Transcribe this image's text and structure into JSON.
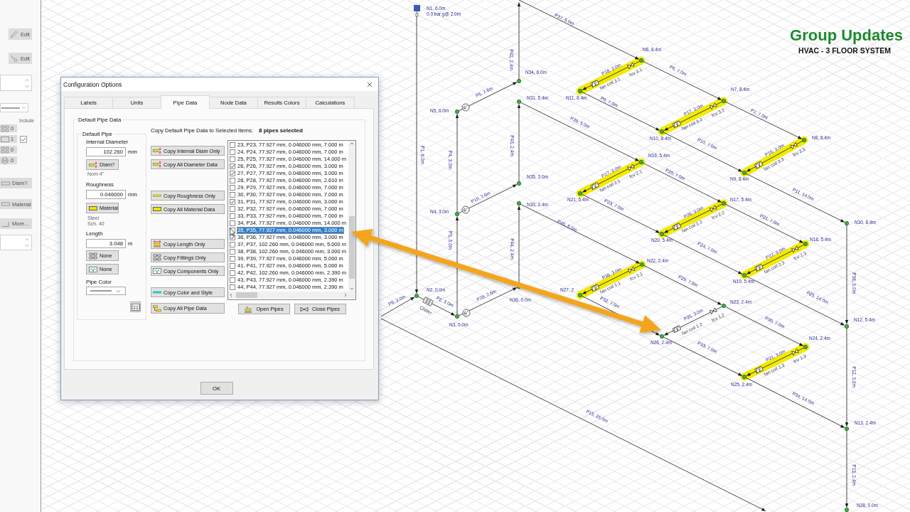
{
  "side_panel": {
    "edit_buttons": [
      {
        "label": "Edit",
        "disabled": true
      },
      {
        "label": "Edit",
        "disabled": true
      }
    ],
    "include": {
      "label": "Include",
      "checked": true
    },
    "counters": [
      "0",
      "1",
      "0",
      "0"
    ],
    "buttons": [
      {
        "label": "Diam?",
        "disabled": true
      },
      {
        "label": "Material",
        "disabled": true
      },
      {
        "label": "More...",
        "disabled": true
      }
    ]
  },
  "dialog": {
    "title": "Configuration Options",
    "tabs": [
      {
        "label": "Labels",
        "selected": false
      },
      {
        "label": "Units",
        "selected": false
      },
      {
        "label": "Pipe Data",
        "selected": true
      },
      {
        "label": "Node Data",
        "selected": false
      },
      {
        "label": "Results Colors",
        "selected": false
      },
      {
        "label": "Calculations",
        "selected": false
      }
    ],
    "group_title": "Default Pipe Data",
    "default_pipe": {
      "title": "Default Pipe",
      "diameter": {
        "label": "Internal Diameter",
        "value": "102.260",
        "unit": "mm",
        "button": "Diam?",
        "notes": [
          "Nom 4\""
        ]
      },
      "roughness": {
        "label": "Roughness",
        "value": "0.046000",
        "unit": "mm",
        "button": "Material",
        "notes": [
          "Steel",
          "Sch. 40"
        ]
      },
      "length": {
        "label": "Length",
        "value": "3.048",
        "unit": "m"
      },
      "fittings_button": "None",
      "components_button": "None",
      "color_label": "Pipe Color"
    },
    "copy_heading": "Copy Default Pipe Data to Selected Items:",
    "selection_count": "8 pipes selected",
    "copy_groups": [
      [
        "Copy Internal Diam Only",
        "Copy All Diameter Data"
      ],
      [
        "Copy Roughness Only",
        "Copy All Material Data"
      ],
      [
        "Copy Length Only",
        "Copy Fittings Only",
        "Copy Components Only"
      ],
      [
        "Copy Color and Style"
      ],
      [
        "Copy All Pipe Data"
      ]
    ],
    "pipe_list": [
      {
        "text": "23, P23, 77.927 mm, 0.046000 mm, 7.000 m",
        "checked": false,
        "selected": false
      },
      {
        "text": "24, P24, 77.927 mm, 0.046000 mm, 7.000 m",
        "checked": false,
        "selected": false
      },
      {
        "text": "25, P25, 77.927 mm, 0.046000 mm, 14.000 m",
        "checked": false,
        "selected": false
      },
      {
        "text": "26, P26, 77.927 mm, 0.046000 mm, 3.000 m",
        "checked": true,
        "selected": false
      },
      {
        "text": "27, P27, 77.927 mm, 0.046000 mm, 3.000 m",
        "checked": true,
        "selected": false
      },
      {
        "text": "28, P28, 77.927 mm, 0.046000 mm, 2.610 m",
        "checked": false,
        "selected": false
      },
      {
        "text": "29, P29, 77.927 mm, 0.046000 mm, 7.000 m",
        "checked": false,
        "selected": false
      },
      {
        "text": "30, P30, 77.927 mm, 0.046000 mm, 7.000 m",
        "checked": false,
        "selected": false
      },
      {
        "text": "31, P31, 77.927 mm, 0.046000 mm, 3.000 m",
        "checked": true,
        "selected": false
      },
      {
        "text": "32, P32, 77.927 mm, 0.046000 mm, 7.000 m",
        "checked": false,
        "selected": false
      },
      {
        "text": "33, P33, 77.927 mm, 0.046000 mm, 7.000 m",
        "checked": false,
        "selected": false
      },
      {
        "text": "34, P34, 77.927 mm, 0.046000 mm, 14.000 m",
        "checked": false,
        "selected": false
      },
      {
        "text": "35, P35, 77.927 mm, 0.046000 mm, 3.000 m",
        "checked": false,
        "selected": true
      },
      {
        "text": "36, P36, 77.927 mm, 0.046000 mm, 3.000 m",
        "checked": true,
        "selected": false
      },
      {
        "text": "37, P37, 102.260 mm, 0.046000 mm, 5.000 m",
        "checked": false,
        "selected": false
      },
      {
        "text": "38, P38, 102.260 mm, 0.046000 mm, 3.000 m",
        "checked": false,
        "selected": false
      },
      {
        "text": "39, P39, 77.927 mm, 0.046000 mm, 5.000 m",
        "checked": false,
        "selected": false
      },
      {
        "text": "41, P41, 77.927 mm, 0.046000 mm, 5.000 m",
        "checked": false,
        "selected": false
      },
      {
        "text": "42, P42, 102.260 mm, 0.046000 mm, 2.390 m",
        "checked": false,
        "selected": false
      },
      {
        "text": "43, P43, 77.927 mm, 0.046000 mm, 2.390 m",
        "checked": false,
        "selected": false
      },
      {
        "text": "44, P44, 77.927 mm, 0.046000 mm, 2.390 m",
        "checked": false,
        "selected": false
      }
    ],
    "list_buttons": [
      "Open Pipes",
      "Close Pipes"
    ],
    "ok_button": "OK"
  },
  "diagram": {
    "title": "Group Updates",
    "subtitle": "HVAC - 3 FLOOR SYSTEM",
    "source": {
      "label": "N1, 6.0m",
      "detail": "0.0 bar.g@ 2.0m"
    },
    "chiller": "Chiller",
    "nodes": [
      "N6, 8.4m",
      "N34, 6.0m",
      "N7, 8.4m",
      "N11, 8.4m",
      "N31, 5.4m",
      "N5, 6.0m",
      "N10, 8.4m",
      "N8, 8.4m",
      "N16, 5.4m",
      "N9, 8.4m",
      "N35, 3.0m",
      "N21, 5.4m",
      "N17, 5.4m",
      "N33, 2.4m",
      "N4, 3.0m",
      "N30, 8.4m",
      "N20, 5.4m",
      "N18, 5.4m",
      "N22, 2.4m",
      "N19, 5.4m",
      "N36, 0.0m",
      "N2, 0.0m",
      "N27, 2",
      "N23, 2.4m",
      "N3, 0.0m",
      "N12, 5.4m",
      "N26, 2.4m",
      "N24, 2.4m",
      "N25, 2.4m",
      "N13, 2.4m",
      "N28, 0.0m"
    ],
    "pipes": [
      "P37, 5.0m",
      "P42, 2.4m",
      "P5, 2.6m",
      "P6, 7.0m",
      "P9, 7.0m",
      "P39, 5.0m",
      "P7, 7.0m",
      "P10, 7.0m",
      "P1, 6.0m",
      "P4, 3.0m",
      "P43, 2.4m",
      "P20, 7.0m",
      "P19, 2.6m",
      "P11, 14.0m",
      "P23, 7.0m",
      "P45, 5.0m",
      "P21, 7.0m",
      "P24, 7.0m",
      "P44, 2.4m",
      "P3, 3.0m",
      "P38, 3.0m",
      "P29, 7.0m",
      "P25, 14.0m",
      "P8, 3.0m",
      "P2, 3.0m",
      "P28, 2.6m",
      "P32, 7.0m",
      "P30, 7.0m",
      "P33, 7.0m",
      "P34, 14.0m",
      "P12, 3.0m",
      "P15, 25.0m",
      "P13, 2.4m"
    ],
    "fan_coils": [
      {
        "pipe": "P18, 3.0m",
        "coil": "fan coil 3.1",
        "valve": "fcv 3.1",
        "selected": true
      },
      {
        "pipe": "P17, 3.0m",
        "coil": "fan coil 3.2",
        "valve": "fcv 3.2",
        "selected": true
      },
      {
        "pipe": "P16, 3.0m",
        "coil": "fan coil 3.3",
        "valve": "fcv 3.3",
        "selected": true
      },
      {
        "pipe": "P27, 3.0m",
        "coil": "fan coil 2.1",
        "valve": "fcv 2.1",
        "selected": true
      },
      {
        "pipe": "P26, 3.0m",
        "coil": "fan coil 2.2",
        "valve": "fcv 2.2",
        "selected": true
      },
      {
        "pipe": "P22, 3.0m",
        "coil": "fan coil 2.3",
        "valve": "fcv 2.3",
        "selected": true
      },
      {
        "pipe": "P36, 3.0m",
        "coil": "fan coil 1.1",
        "valve": "fcv 1.1",
        "selected": true
      },
      {
        "pipe": "P35, 3.0m",
        "coil": "fan coil 1.2",
        "valve": "fcv 1.2",
        "selected": false
      },
      {
        "pipe": "P31, 3.0m",
        "coil": "fan coil 1.3",
        "valve": "fcv 1.3",
        "selected": true
      }
    ]
  }
}
